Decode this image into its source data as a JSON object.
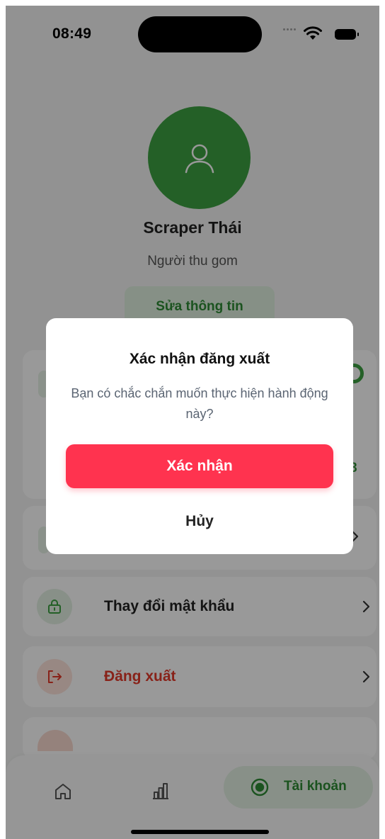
{
  "status_bar": {
    "time": "08:49"
  },
  "profile": {
    "name": "Scraper Thái",
    "role": "Người thu gom",
    "edit_label": "Sửa thông tin"
  },
  "stats": {
    "value": "8"
  },
  "menu": {
    "change_password": "Thay đổi mật khẩu",
    "logout": "Đăng xuất"
  },
  "tabbar": {
    "account_label": "Tài khoản"
  },
  "dialog": {
    "title": "Xác nhận đăng xuất",
    "message": "Bạn có chắc chắn muốn thực hiện hành động này?",
    "confirm_label": "Xác nhận",
    "cancel_label": "Hủy"
  },
  "colors": {
    "brand_green": "#3da142",
    "danger_red": "#ff334f",
    "logout_red": "#e33a2a"
  }
}
